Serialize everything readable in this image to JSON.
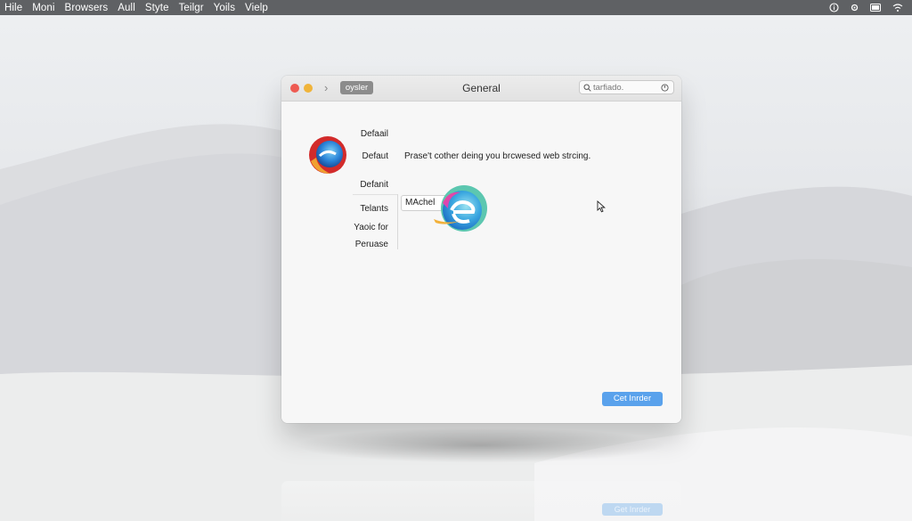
{
  "menubar": {
    "items": [
      "Hile",
      "Moni",
      "Browsers",
      "Aull",
      "Styte",
      "Teilgr",
      "Yoils",
      "Vielp"
    ],
    "status_icons": [
      "info-circle-icon",
      "gear-icon",
      "battery-icon",
      "wifi-icon"
    ]
  },
  "window": {
    "title": "General",
    "tab_label": "oysler",
    "search_placeholder": "tarfiado.",
    "labels": {
      "default_1": "Defaail",
      "default_2": "Defaut",
      "default_3": "Defanit",
      "telants": "Telants",
      "yaoic_for": "Yaoic for",
      "peruase": "Peruase"
    },
    "description": "Prase't cother deing you brcwesed web strcing.",
    "field_value": "MAchel",
    "primary_button": "Cet Inrder",
    "reflection_button": "Get Inrder"
  },
  "colors": {
    "menubar": "#5f6164",
    "accent_button": "#5aa2ec",
    "close": "#ee5b52",
    "minimize": "#f0b43a"
  }
}
